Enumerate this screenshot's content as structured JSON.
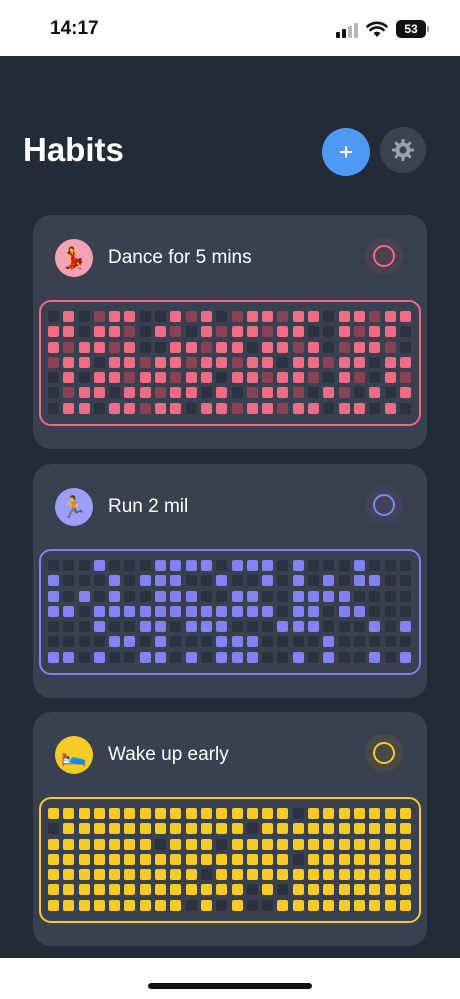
{
  "status_bar": {
    "time": "14:17",
    "battery": "53"
  },
  "header": {
    "title": "Habits",
    "add_icon": "plus-icon",
    "settings_icon": "gear-icon"
  },
  "habits": [
    {
      "name": "Dance for 5 mins",
      "emoji": "💃",
      "color": "#f06b84",
      "dim_color": "#8a4257",
      "emoji_bg": "#f4a3b4",
      "check_bg": "#4a4150",
      "grid": [
        "010111001110111111011111",
        "110111011011111110011110",
        "111111001111101111011110",
        "111011111111111011111011",
        "010111111110111111011011",
        "011101111101011110110101",
        "011011111011111111011010"
      ]
    },
    {
      "name": "Run 2 mil",
      "emoji": "🏃",
      "color": "#8382f0",
      "dim_color": "#8382f0",
      "emoji_bg": "#9f9ef6",
      "check_bg": "#40445a",
      "grid": [
        "000100011110111010001000",
        "100010111001001010101100",
        "101010011100110011110000",
        "110111111111111011011000",
        "000100110111000111000101",
        "000011010001110000100000",
        "110100110101110010100101"
      ]
    },
    {
      "name": "Wake up early",
      "emoji": "🛌",
      "color": "#f6cb26",
      "dim_color": "#f6cb26",
      "emoji_bg": "#f6cb26",
      "check_bg": "#4a4a45",
      "grid": [
        "111111111111111101111111",
        "011111111111101111111111",
        "111111101110111111111111",
        "111111111111111101111111",
        "111111111101111111111111",
        "111111111111101011111111",
        "111111111010100111111111"
      ]
    }
  ]
}
